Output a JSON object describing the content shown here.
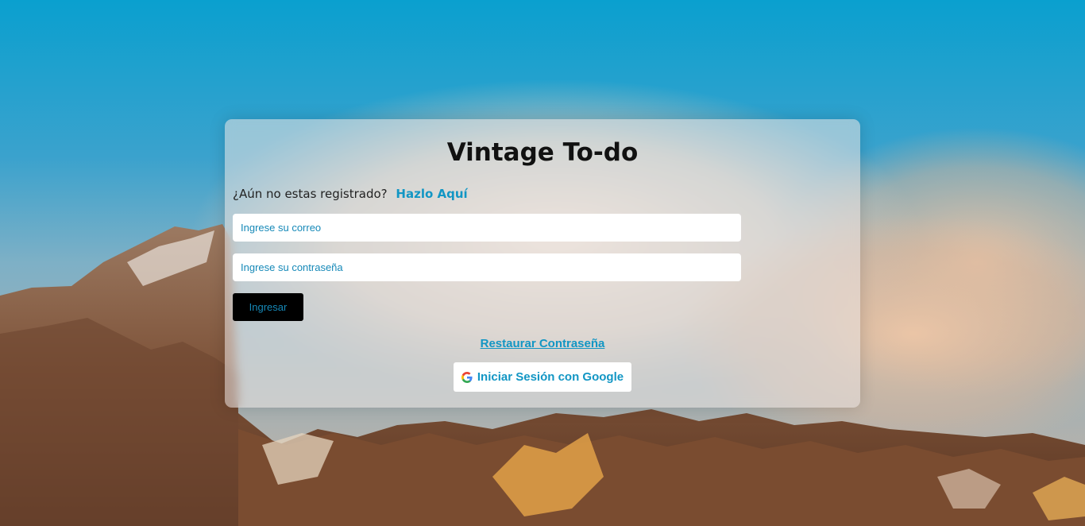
{
  "app": {
    "title": "Vintage To-do"
  },
  "register": {
    "prompt": "¿Aún no estas registrado?",
    "link": "Hazlo Aquí"
  },
  "form": {
    "email_placeholder": "Ingrese su correo",
    "password_placeholder": "Ingrese su contraseña",
    "submit_label": "Ingresar"
  },
  "links": {
    "restore_password": "Restaurar Contraseña"
  },
  "google": {
    "label": "Iniciar Sesión con Google",
    "icon": "google-icon"
  },
  "colors": {
    "accent": "#1296c4",
    "title": "#111111",
    "button_bg": "#000000"
  }
}
